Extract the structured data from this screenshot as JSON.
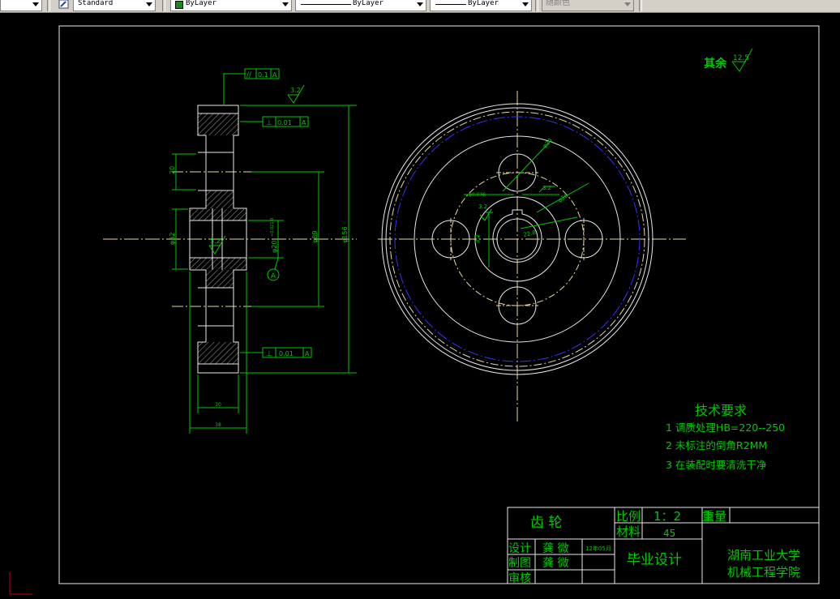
{
  "toolbar": {
    "text_style": "Standard",
    "layer": "ByLayer",
    "linetype": "ByLayer",
    "lineweight": "ByLayer",
    "plot_style": "随颜色"
  },
  "colors": {
    "background": "#000000",
    "line_white": "#e8e8e8",
    "dimension_green": "#00c800",
    "center_yellow": "#e8d8a0",
    "pitch_blue": "#3333ff",
    "hatch": "#c8c8c8",
    "title_text": "#00c800"
  },
  "section_view": {
    "geo_tolerance_top": [
      "//",
      "0.1",
      "A"
    ],
    "runout_top": [
      "⊥",
      "0.01",
      "A"
    ],
    "runout_bottom": [
      "⊥",
      "0.01",
      "A"
    ],
    "roughness_top": "3.2",
    "roughness_bore": "3.2",
    "dim_outer": "φ156",
    "dim_hub": "φ89",
    "dim_bore": "φ20",
    "dim_bore_tol": "+0.021 0",
    "dim_hub_outer": "φ32",
    "dim_hole_spacing": "20",
    "dim_width_inner": "30",
    "dim_width_outer": "38",
    "datum": "A"
  },
  "front_view": {
    "dim_hole": "φ20",
    "dim_pitch": "φ36",
    "dim_keyway": "22.8",
    "dim_chamfer": "3.2",
    "roughness_keyway": "3.2",
    "dim_small": "φ0.036",
    "dim_diag": "3.2"
  },
  "roughness_note": {
    "label": "其余",
    "value": "12.5"
  },
  "tech_requirements": {
    "title": "技术要求",
    "items": [
      "1  调质处理HB=220--250",
      "2  未标注的倒角R2MM",
      "3  在装配时要清洗干净"
    ]
  },
  "title_block": {
    "part_name": "齿    轮",
    "scale_label": "比例",
    "scale_value": "1：2",
    "weight_label": "重量",
    "material_label": "材料",
    "material_value": "45",
    "designer_label": "设计",
    "designer_name": "龚 微",
    "date": "12年05月",
    "drafter_label": "制图",
    "drafter_name": "龚 微",
    "reviewer_label": "审核",
    "project": "毕业设计",
    "school_line1": "湖南工业大学",
    "school_line2": "机械工程学院"
  }
}
